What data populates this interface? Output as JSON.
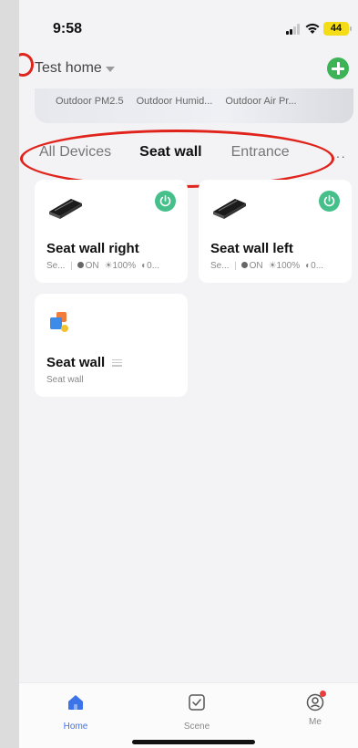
{
  "status_bar": {
    "time": "9:58",
    "battery": "44"
  },
  "home": {
    "title": "Test home"
  },
  "weather": {
    "items": [
      "Outdoor PM2.5",
      "Outdoor Humid...",
      "Outdoor Air Pr..."
    ]
  },
  "tabs": [
    {
      "label": "All Devices",
      "active": false
    },
    {
      "label": "Seat wall",
      "active": true
    },
    {
      "label": "Entrance",
      "active": false
    }
  ],
  "more_label": "···",
  "devices": [
    {
      "name": "Seat wall right",
      "status_prefix": "Se...",
      "status_power": "ON",
      "status_brightness": "☀100%",
      "status_extra": "◐0..."
    },
    {
      "name": "Seat wall left",
      "status_prefix": "Se...",
      "status_power": "ON",
      "status_brightness": "☀100%",
      "status_extra": "◐0..."
    }
  ],
  "group": {
    "name": "Seat wall",
    "subtitle": "Seat wall"
  },
  "nav": [
    {
      "label": "Home",
      "icon": "home-icon",
      "active": true
    },
    {
      "label": "Scene",
      "icon": "scene-checkbox-icon",
      "active": false
    },
    {
      "label": "Me",
      "icon": "profile-icon",
      "active": false
    }
  ],
  "colors": {
    "accent_green": "#3cb357",
    "power_green": "#45c08a",
    "nav_active": "#3d73e8",
    "annotation_red": "#e0231b"
  }
}
